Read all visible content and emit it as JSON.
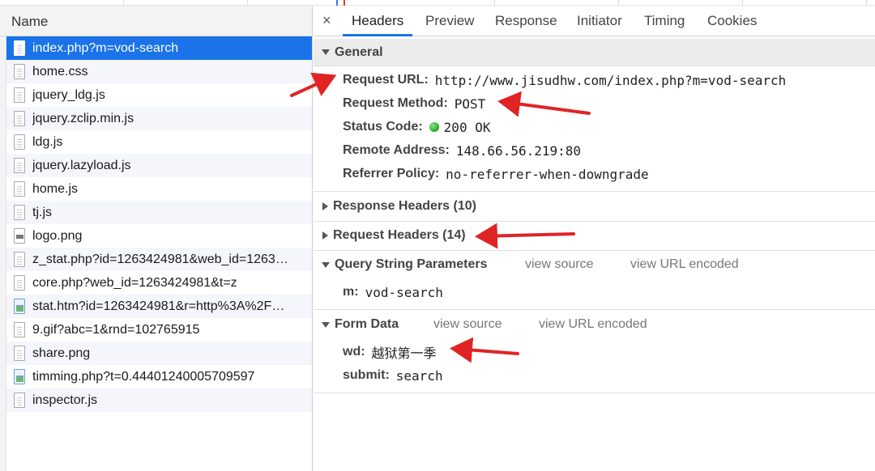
{
  "request_list": {
    "header": "Name",
    "items": [
      {
        "name": "index.php?m=vod-search",
        "icon": "file-icon"
      },
      {
        "name": "home.css",
        "icon": "file-icon"
      },
      {
        "name": "jquery_ldg.js",
        "icon": "file-icon"
      },
      {
        "name": "jquery.zclip.min.js",
        "icon": "file-icon"
      },
      {
        "name": "ldg.js",
        "icon": "file-icon"
      },
      {
        "name": "jquery.lazyload.js",
        "icon": "file-icon"
      },
      {
        "name": "home.js",
        "icon": "file-icon"
      },
      {
        "name": "tj.js",
        "icon": "file-icon"
      },
      {
        "name": "logo.png",
        "icon": "image-icon"
      },
      {
        "name": "z_stat.php?id=1263424981&web_id=1263…",
        "icon": "file-icon"
      },
      {
        "name": "core.php?web_id=1263424981&t=z",
        "icon": "file-icon"
      },
      {
        "name": "stat.htm?id=1263424981&r=http%3A%2F…",
        "icon": "broken-image-icon"
      },
      {
        "name": "9.gif?abc=1&rnd=102765915",
        "icon": "file-icon"
      },
      {
        "name": "share.png",
        "icon": "file-icon"
      },
      {
        "name": "timming.php?t=0.44401240005709597",
        "icon": "broken-image-icon"
      },
      {
        "name": "inspector.js",
        "icon": "file-icon"
      }
    ]
  },
  "detail_tabs": {
    "close": "×",
    "tabs": [
      "Headers",
      "Preview",
      "Response",
      "Initiator",
      "Timing",
      "Cookies"
    ],
    "active": "Headers"
  },
  "general": {
    "title": "General",
    "request_url_label": "Request URL:",
    "request_url": "http://www.jisudhw.com/index.php?m=vod-search",
    "request_method_label": "Request Method:",
    "request_method": "POST",
    "status_code_label": "Status Code:",
    "status_code": "200 OK",
    "remote_address_label": "Remote Address:",
    "remote_address": "148.66.56.219:80",
    "referrer_policy_label": "Referrer Policy:",
    "referrer_policy": "no-referrer-when-downgrade"
  },
  "response_headers": {
    "title": "Response Headers (10)"
  },
  "request_headers": {
    "title": "Request Headers (14)"
  },
  "query_string": {
    "title": "Query String Parameters",
    "view_source": "view source",
    "view_url_encoded": "view URL encoded",
    "params": [
      {
        "key": "m:",
        "value": "vod-search"
      }
    ]
  },
  "form_data": {
    "title": "Form Data",
    "view_source": "view source",
    "view_url_encoded": "view URL encoded",
    "params": [
      {
        "key": "wd:",
        "value": "越狱第一季"
      },
      {
        "key": "submit:",
        "value": "search"
      }
    ]
  },
  "colors": {
    "selected_row": "#1a73e8",
    "active_tab_underline": "#1a73e8",
    "annotation_arrow": "#e02424",
    "status_ok": "#1fa51f"
  }
}
